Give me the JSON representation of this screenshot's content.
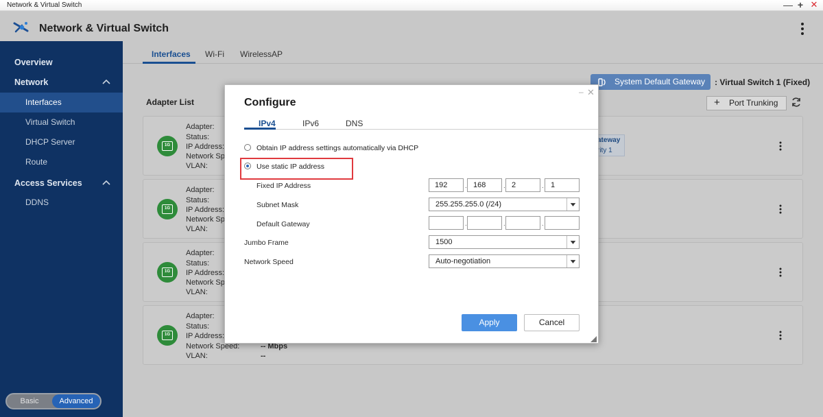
{
  "os": {
    "title": "Network & Virtual Switch",
    "min": "—",
    "max": "+",
    "close": "✕"
  },
  "app": {
    "title": "Network & Virtual Switch"
  },
  "sidebar": {
    "overview": "Overview",
    "network": "Network",
    "network_items": [
      "Interfaces",
      "Virtual Switch",
      "DHCP Server",
      "Route"
    ],
    "access": "Access Services",
    "access_items": [
      "DDNS"
    ],
    "mode": {
      "basic": "Basic",
      "advanced": "Advanced"
    }
  },
  "tabs": [
    "Interfaces",
    "Wi-Fi",
    "WirelessAP"
  ],
  "gateway": {
    "button": "System Default Gateway",
    "value": ": Virtual Switch 1 (Fixed)"
  },
  "adapter_list": {
    "title": "Adapter List",
    "port_trunking": "Port Trunking"
  },
  "adapter_labels": [
    "Adapter:",
    "Status:",
    "IP Address:",
    "Network Speed:",
    "VLAN:"
  ],
  "nic_badge": "1G",
  "card4_values": {
    "speed": "-- Mbps",
    "vlan": "--"
  },
  "ghost_badge": {
    "line1": "ateway",
    "line2": "rity 1"
  },
  "dialog": {
    "title": "Configure",
    "tabs": [
      "IPv4",
      "IPv6",
      "DNS"
    ],
    "option_dhcp": "Obtain IP address settings automatically via DHCP",
    "option_static": "Use static IP address",
    "fixed_ip_label": "Fixed IP Address",
    "fixed_ip": [
      "192",
      "168",
      "2",
      "1"
    ],
    "subnet_label": "Subnet Mask",
    "subnet_value": "255.255.255.0 (/24)",
    "gateway_label": "Default Gateway",
    "gateway_ip": [
      "",
      "",
      "",
      ""
    ],
    "jumbo_label": "Jumbo Frame",
    "jumbo_value": "1500",
    "speed_label": "Network Speed",
    "speed_value": "Auto-negotiation",
    "apply": "Apply",
    "cancel": "Cancel",
    "minimize": "–",
    "close": "✕"
  }
}
